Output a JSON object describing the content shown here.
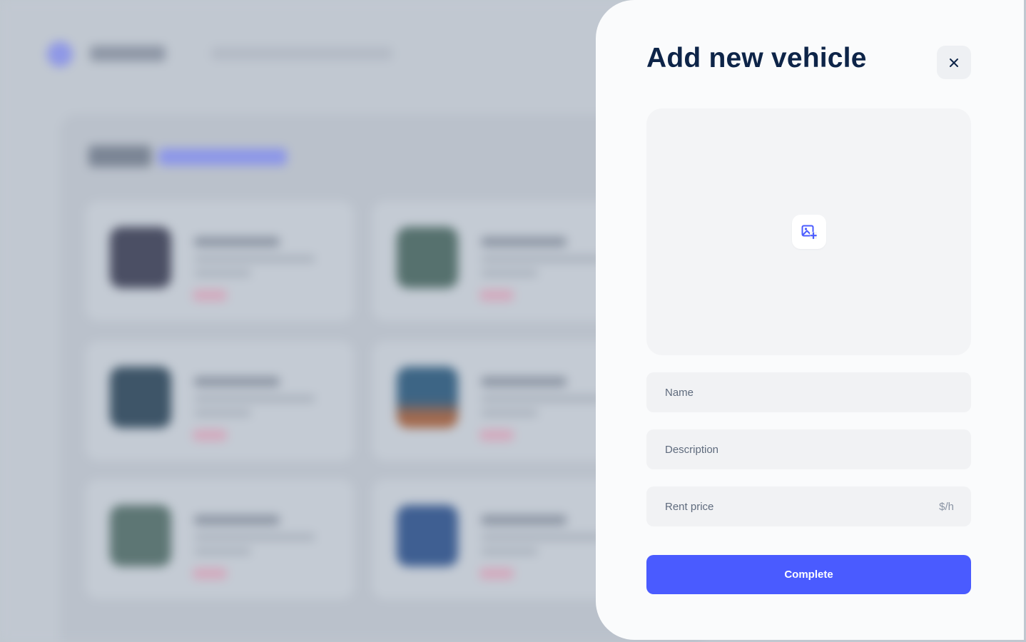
{
  "modal": {
    "title": "Add new vehicle",
    "close_icon": "close-icon",
    "upload_icon": "image-plus-icon",
    "fields": {
      "name": {
        "placeholder": "Name",
        "value": ""
      },
      "description": {
        "placeholder": "Description",
        "value": ""
      },
      "rent_price": {
        "placeholder": "Rent price",
        "value": "",
        "suffix": "$/h"
      }
    },
    "submit_label": "Complete"
  },
  "colors": {
    "accent": "#4a5bff",
    "title": "#0d2448",
    "overlay": "#c1c8d1",
    "drawer_bg": "#fafbfc"
  }
}
